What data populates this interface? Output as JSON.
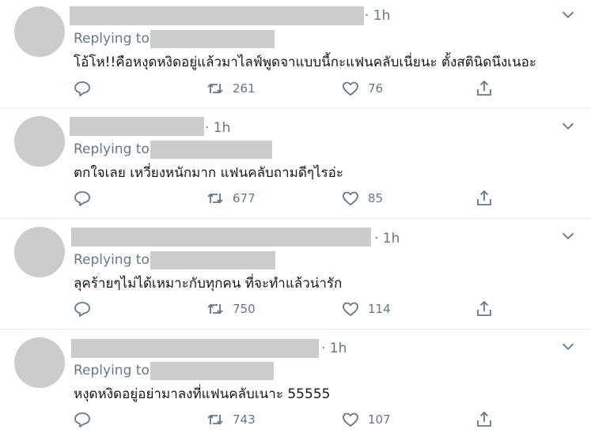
{
  "tweets": [
    {
      "time": "· 1h",
      "replying_label": "Replying to",
      "text": "โอ้โห!!คือหงุดหงิดอยู่แล้วมาไลฟ์พูดจาแบบนี้กะแฟนคลับเนี่ยนะ ตั้งสตินิดนึงเนอะ",
      "retweets": "261",
      "likes": "76"
    },
    {
      "time": "· 1h",
      "replying_label": "Replying to",
      "text": "ตกใจเลย เหวี่ยงหนักมาก แฟนคลับถามดีๆไรอ่ะ",
      "retweets": "677",
      "likes": "85"
    },
    {
      "time": "· 1h",
      "replying_label": "Replying to",
      "text": "ลุคร้ายๆไม่ได้เหมาะกับทุกคน ที่จะทำแล้วน่ารัก",
      "retweets": "750",
      "likes": "114"
    },
    {
      "time": "· 1h",
      "replying_label": "Replying to",
      "text": "หงุดหงิดอยู่อย่ามาลงที่แฟนคลับเนาะ 55555",
      "retweets": "743",
      "likes": "107"
    }
  ],
  "icons": {
    "reply": "reply-icon",
    "retweet": "retweet-icon",
    "like": "heart-icon",
    "share": "share-icon",
    "more": "chevron-down-icon"
  },
  "colors": {
    "text": "#14171a",
    "muted": "#657786",
    "placeholder": "#cccccc",
    "divider": "#e6ecf0"
  }
}
